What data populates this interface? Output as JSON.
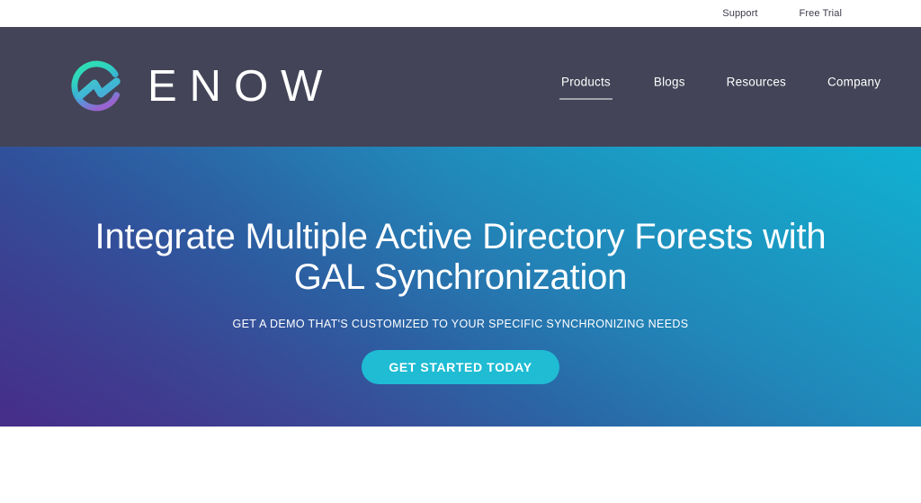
{
  "topbar": {
    "links": [
      {
        "label": "Support",
        "name": "support-link"
      },
      {
        "label": "Free Trial",
        "name": "free-trial-link"
      }
    ]
  },
  "navbar": {
    "brand": {
      "wordmark": "ENOW",
      "logo_icon": "enow-circle-logo-icon",
      "logo_gradient_start": "#2fd9b0",
      "logo_gradient_mid": "#33b6d4",
      "logo_gradient_end": "#8a63d2"
    },
    "background_color": "#434457",
    "menu": [
      {
        "label": "Products",
        "active": true
      },
      {
        "label": "Blogs",
        "active": false
      },
      {
        "label": "Resources",
        "active": false
      },
      {
        "label": "Company",
        "active": false
      }
    ]
  },
  "hero": {
    "title": "Integrate Multiple Active Directory Forests with GAL Synchronization",
    "subtitle": "GET A DEMO THAT'S CUSTOMIZED TO YOUR SPECIFIC SYNCHRONIZING NEEDS",
    "cta_label": "GET STARTED TODAY",
    "cta_color": "#1fbcd4",
    "gradient_top_right": "#16aacd",
    "gradient_bottom_left": "#473089",
    "gradient_bottom_right": "#2c6fa8",
    "gradient_top_left": "#2477b4"
  }
}
